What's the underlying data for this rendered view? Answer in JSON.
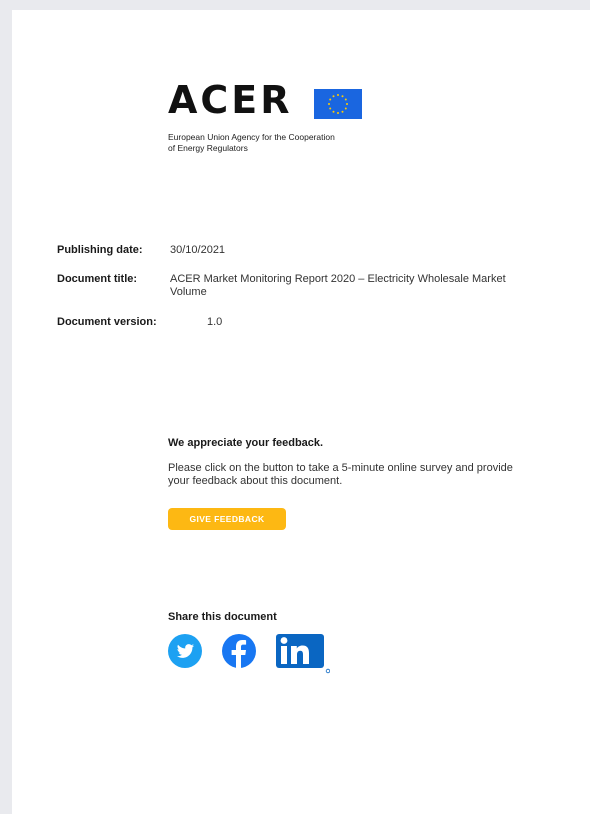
{
  "logo": {
    "wordmark": "ACER",
    "subtitle_line1": "European Union Agency for the Cooperation",
    "subtitle_line2": "of Energy Regulators",
    "flag_icon": "eu-flag-icon"
  },
  "metadata": {
    "publishing_date_label": "Publishing date:",
    "publishing_date_value": "30/10/2021",
    "document_title_label": "Document title:",
    "document_title_value": "ACER Market Monitoring Report 2020 – Electricity Wholesale Market Volume",
    "document_version_label": "Document version:",
    "document_version_value": "1.0"
  },
  "feedback": {
    "heading": "We appreciate your feedback.",
    "text": "Please click on the button to take a 5-minute online survey and provide your feedback about this document.",
    "button_label": "GIVE FEEDBACK"
  },
  "share": {
    "heading": "Share this document",
    "icons": [
      "twitter-icon",
      "facebook-icon",
      "linkedin-icon"
    ]
  },
  "colors": {
    "button": "#fdb813",
    "twitter": "#1da1f2",
    "facebook": "#1877f2",
    "linkedin": "#0a66c2",
    "eu_blue": "#1a66e0",
    "eu_star": "#ffcc00"
  }
}
